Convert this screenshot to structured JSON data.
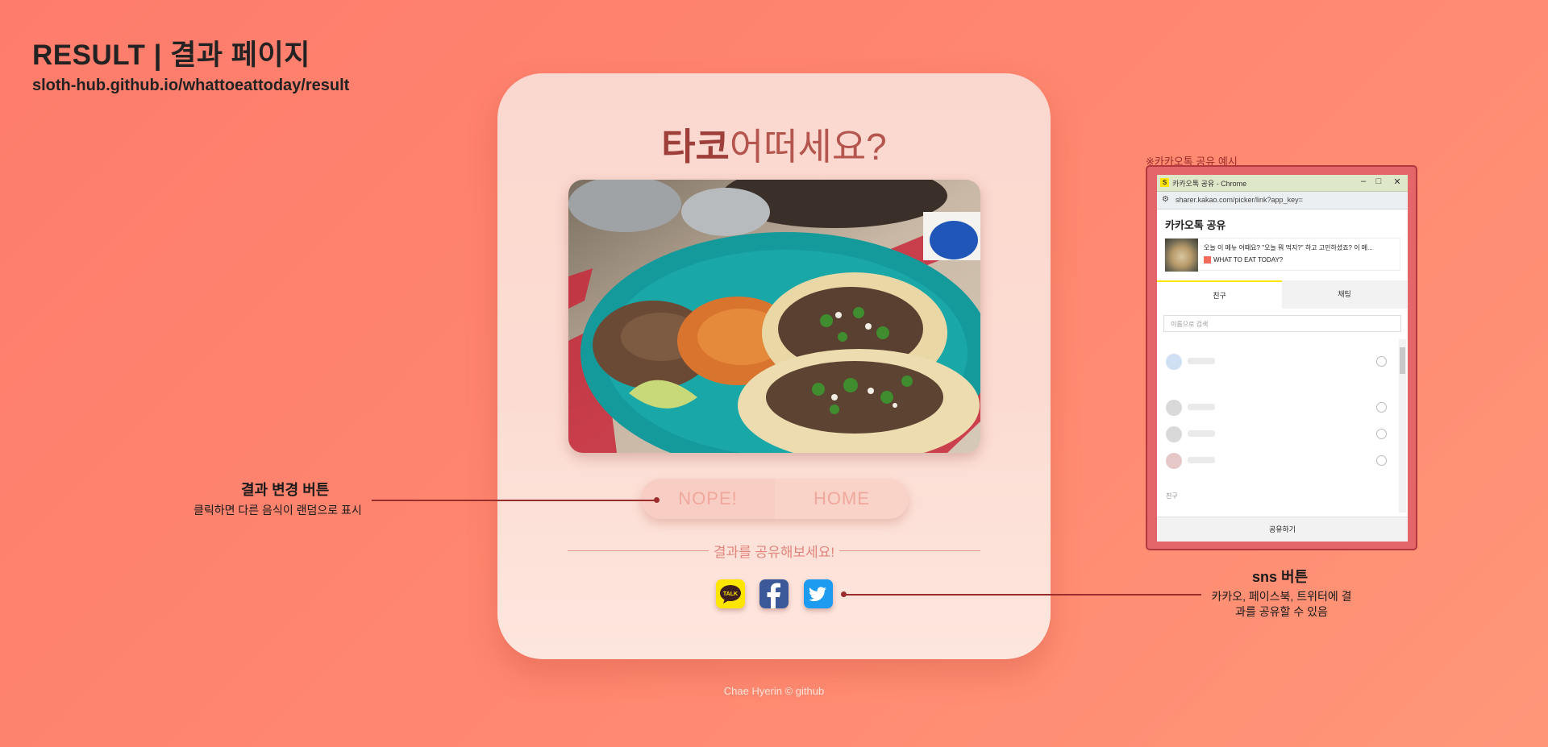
{
  "header": {
    "title": "RESULT | 결과 페이지",
    "url": "sloth-hub.github.io/whattoeattoday/result"
  },
  "card": {
    "food_name": "타코",
    "question": "어떠세요?",
    "photo_icon": "tacos-photo",
    "buttons": {
      "nope": "NOPE!",
      "home": "HOME"
    },
    "share_text": "결과를 공유해보세요!",
    "sns": [
      {
        "name": "kakao",
        "label": "TALK",
        "color": "#fee500"
      },
      {
        "name": "facebook",
        "label": "f",
        "color": "#3b5998"
      },
      {
        "name": "twitter",
        "label": "twitter-bird",
        "color": "#1d9bf0"
      }
    ]
  },
  "footer": "Chae Hyerin © github",
  "annotations": {
    "result_button": {
      "title": "결과 변경 버튼",
      "desc": "클릭하면 다른 음식이 랜덤으로 표시"
    },
    "sns_button": {
      "title": "sns 버튼",
      "desc_line1": "카카오, 페이스북, 트위터에 결",
      "desc_line2": "과를 공유할 수 있음"
    },
    "kakao_example_label": "※카카오톡 공유 예시"
  },
  "kakao_popup": {
    "window_title": "카카오톡 공유 - Chrome",
    "address": "sharer.kakao.com/picker/link?app_key=",
    "heading": "카카오톡 공유",
    "preview_line1": "오늘 이 메뉴 어때요? \"오늘 뭐 먹지?\" 하고 고민하셨죠? 이 메...",
    "preview_line2": "WHAT TO EAT TODAY?",
    "tabs": [
      "친구",
      "채팅"
    ],
    "search_placeholder": "이름으로 검색",
    "section_friends": "친구",
    "share_button": "공유하기"
  },
  "colors": {
    "background": "#fe7c6c",
    "card": "#fbd8cf",
    "accent": "#9e3f3a",
    "annotation_line": "#9a2c2c"
  }
}
